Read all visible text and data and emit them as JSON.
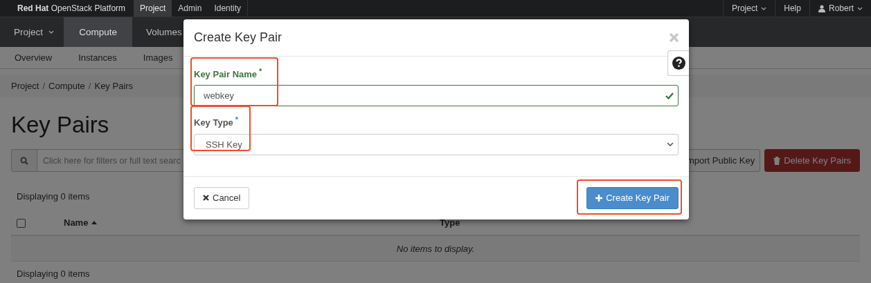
{
  "top_bar": {
    "brand": {
      "maker": "Red Hat",
      "product": "OpenStack Platform"
    },
    "tabs": [
      {
        "label": "Project",
        "selected": true
      },
      {
        "label": "Admin",
        "selected": false
      },
      {
        "label": "Identity",
        "selected": false
      }
    ],
    "right_menu": [
      {
        "label": "Project",
        "kind": "dropdown"
      },
      {
        "label": "Help",
        "kind": "link"
      },
      {
        "label": "Robert",
        "kind": "user"
      }
    ]
  },
  "main_nav": [
    {
      "label": "Project",
      "kind": "dropdown",
      "selected": false
    },
    {
      "label": "Compute",
      "kind": "link",
      "selected": true
    },
    {
      "label": "Volumes",
      "kind": "link",
      "selected": false
    }
  ],
  "sub_nav": [
    "Overview",
    "Instances",
    "Images"
  ],
  "breadcrumb": [
    {
      "kind": "link",
      "label": "Project"
    },
    {
      "kind": "separator",
      "label": "/"
    },
    {
      "kind": "link",
      "label": "Compute"
    },
    {
      "kind": "separator",
      "label": "/"
    },
    {
      "kind": "current",
      "label": "Key Pairs"
    }
  ],
  "page_title": "Key Pairs",
  "search": {
    "placeholder": "Click here for filters or full text searc"
  },
  "actions": [
    {
      "label": "mport Public Key",
      "kind": "default",
      "disabled": false
    },
    {
      "label": "Delete Key Pairs",
      "kind": "danger",
      "disabled": true
    }
  ],
  "table": {
    "count_top": "Displaying 0 items",
    "select_all": {
      "checked": false
    },
    "columns": [
      {
        "label": "Name",
        "sorted": true
      },
      {
        "label": "Type",
        "sorted": false
      }
    ],
    "empty_message": "No items to display.",
    "count_bottom": "Displaying 0 items"
  },
  "dialog": {
    "title": "Create Key Pair",
    "fields": [
      {
        "label": "Key Pair Name",
        "required_mark": "*",
        "kind": "text",
        "value": "webkey",
        "valid": true,
        "highlighted": true
      },
      {
        "label": "Key Type",
        "required_mark": "*",
        "kind": "select",
        "value": "SSH Key",
        "valid": false,
        "highlighted": true
      }
    ],
    "buttons": [
      {
        "label": "Cancel",
        "kind": "cancel"
      },
      {
        "label": "Create Key Pair",
        "kind": "primary",
        "highlighted": true
      }
    ]
  }
}
